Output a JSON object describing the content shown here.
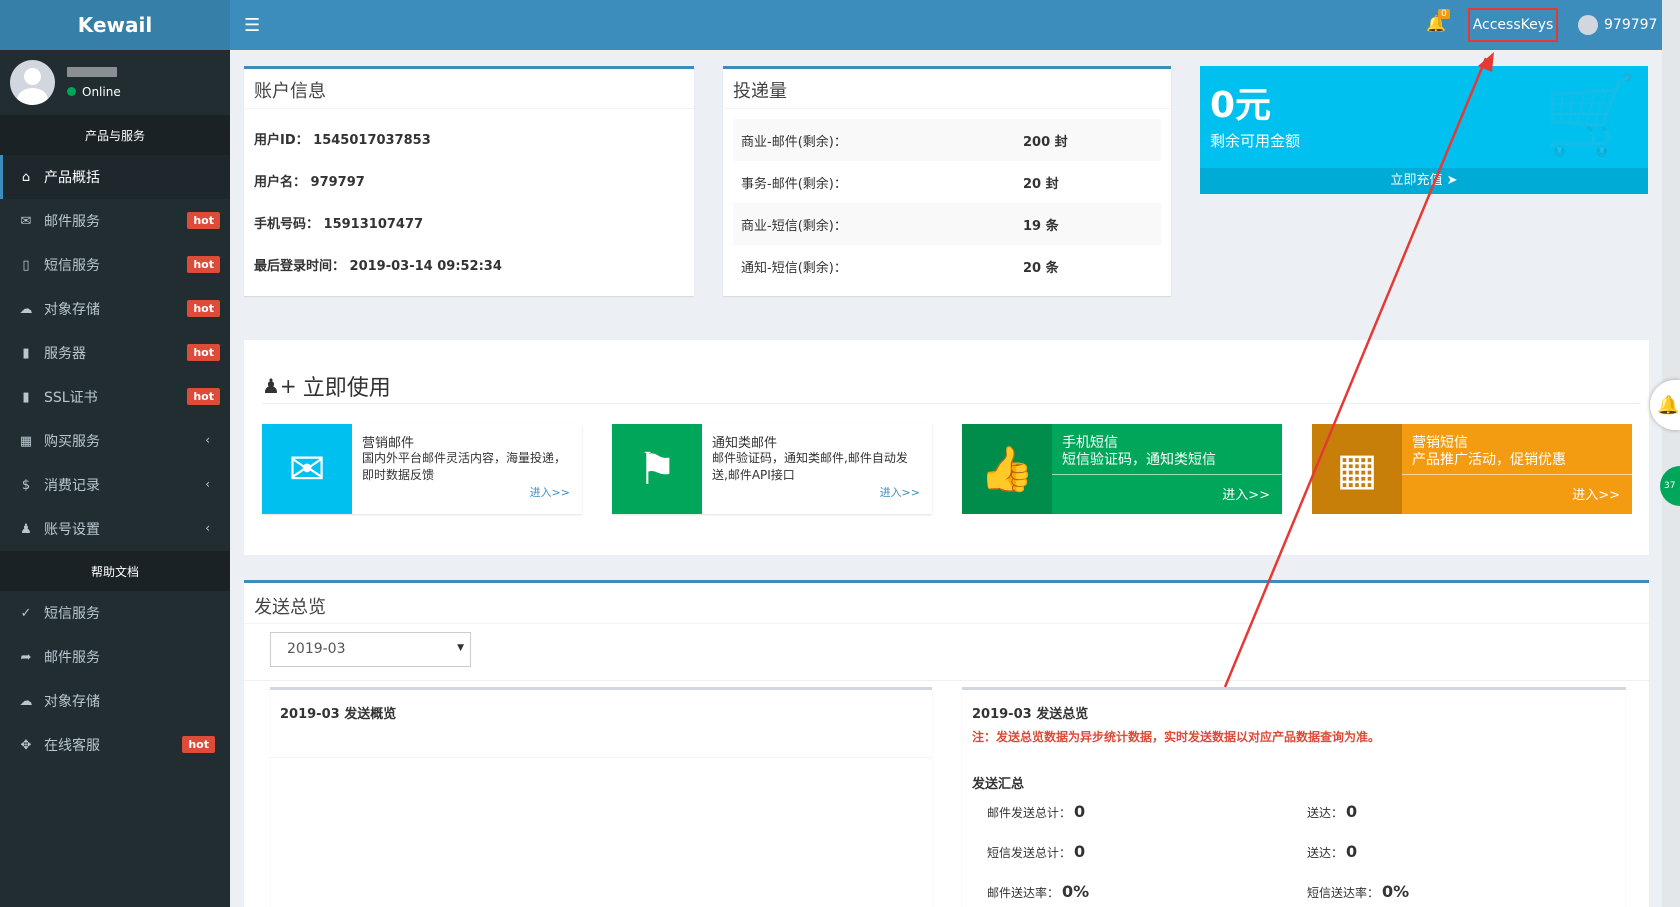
{
  "app": {
    "logo": "Kewail"
  },
  "user_panel": {
    "status": "Online"
  },
  "sidebar": {
    "section_products": "产品与服务",
    "items": [
      {
        "label": "产品概括",
        "icon": "home-icon"
      },
      {
        "label": "邮件服务",
        "icon": "envelope-icon",
        "badge": "hot"
      },
      {
        "label": "短信服务",
        "icon": "mobile-icon",
        "badge": "hot"
      },
      {
        "label": "对象存储",
        "icon": "cloud-icon",
        "badge": "hot"
      },
      {
        "label": "服务器",
        "icon": "book-icon",
        "badge": "hot"
      },
      {
        "label": "SSL证书",
        "icon": "book-icon",
        "badge": "hot"
      },
      {
        "label": "购买服务",
        "icon": "grid-icon"
      },
      {
        "label": "消费记录",
        "icon": "dollar-icon"
      },
      {
        "label": "账号设置",
        "icon": "user-icon"
      }
    ],
    "section_help": "帮助文档",
    "help_items": [
      {
        "label": "短信服务",
        "icon": "wrench-icon"
      },
      {
        "label": "邮件服务",
        "icon": "share-icon"
      },
      {
        "label": "对象存储",
        "icon": "cloud-icon"
      },
      {
        "label": "在线客服",
        "icon": "move-icon",
        "badge": "hot"
      }
    ]
  },
  "header": {
    "notification_count": "0",
    "access_keys": "AccessKeys",
    "username": "979797"
  },
  "account_info": {
    "title": "账户信息",
    "user_id_label": "用户ID：",
    "user_id": "1545017037853",
    "username_label": "用户名：",
    "username": "979797",
    "phone_label": "手机号码：",
    "phone": "15913107477",
    "last_login_label": "最后登录时间：",
    "last_login": "2019-03-14 09:52:34"
  },
  "delivery": {
    "title": "投递量",
    "rows": [
      {
        "label": "商业-邮件(剩余)：",
        "value": "200 封"
      },
      {
        "label": "事务-邮件(剩余)：",
        "value": "20 封"
      },
      {
        "label": "商业-短信(剩余)：",
        "value": "19 条"
      },
      {
        "label": "通知-短信(剩余)：",
        "value": "20 条"
      }
    ]
  },
  "balance": {
    "amount": "0元",
    "label": "剩余可用金额",
    "recharge": "立即充值"
  },
  "quick_use": {
    "title": "立即使用",
    "tiles": [
      {
        "name": "营销邮件",
        "desc": "国内外平台邮件灵活内容，海量投递，即时数据反馈",
        "link": "进入>>",
        "color": "#00c0ef"
      },
      {
        "name": "通知类邮件",
        "desc": "邮件验证码，通知类邮件,邮件自动发送,邮件API接口",
        "link": "进入>>",
        "color": "#00a65a"
      },
      {
        "name": "手机短信",
        "desc": "短信验证码，通知类短信",
        "link": "进入>>",
        "color": "#00a65a"
      },
      {
        "name": "营销短信",
        "desc": "产品推广活动，促销优惠",
        "link": "进入>>",
        "color": "#f39c12"
      }
    ]
  },
  "overview": {
    "title": "发送总览",
    "month": "2019-03",
    "left_title": "2019-03 发送概览",
    "right_title": "2019-03  发送总览",
    "note": "注：发送总览数据为异步统计数据，实时发送数据以对应产品数据查询为准。",
    "summary_title": "发送汇总",
    "metrics": {
      "mail_total_label": "邮件发送总计：",
      "mail_total": "0",
      "mail_delivered_label": "送达：",
      "mail_delivered": "0",
      "sms_total_label": "短信发送总计：",
      "sms_total": "0",
      "sms_delivered_label": "送达：",
      "sms_delivered": "0",
      "mail_rate_label": "邮件送达率：",
      "mail_rate": "0%",
      "sms_rate_label": "短信送达率：",
      "sms_rate": "0%"
    }
  },
  "side_float": {
    "green_label": "37"
  },
  "colors": {
    "accent": "#3c8dbc",
    "sidebar": "#222d32",
    "hot": "#dd4b39",
    "aqua": "#00c0ef",
    "green": "#00a65a",
    "orange": "#f39c12",
    "annotation": "#e53935"
  }
}
